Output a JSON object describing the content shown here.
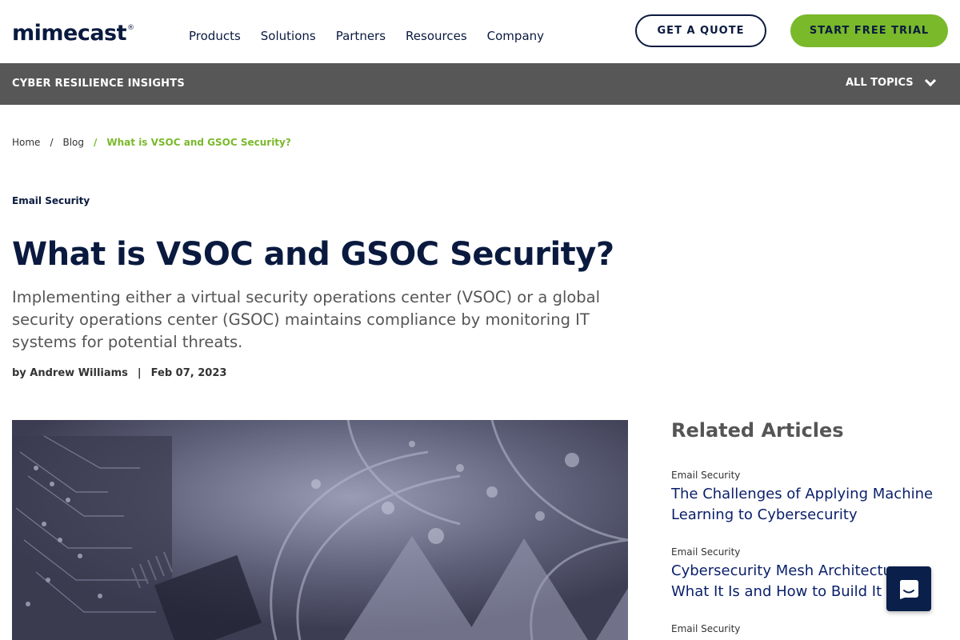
{
  "header": {
    "logo": "mimecast",
    "logo_mark": "®",
    "nav": [
      "Products",
      "Solutions",
      "Partners",
      "Resources",
      "Company"
    ],
    "quote_label": "GET A QUOTE",
    "trial_label": "START FREE TRIAL"
  },
  "subbar": {
    "title": "CYBER RESILIENCE INSIGHTS",
    "topics_label": "ALL TOPICS"
  },
  "breadcrumb": {
    "home": "Home",
    "blog": "Blog",
    "separator": "/",
    "current": "What is VSOC and GSOC Security?"
  },
  "article": {
    "category": "Email Security",
    "title": "What is VSOC and GSOC Security?",
    "subtitle": "Implementing either a virtual security operations center (VSOC) or a global security operations center (GSOC) maintains compliance by monitoring IT systems for potential threats.",
    "author": "by Andrew Williams",
    "byline_separator": "|",
    "date": "Feb 07, 2023"
  },
  "related": {
    "heading": "Related Articles",
    "items": [
      {
        "category": "Email Security",
        "title": "The Challenges of Applying Machine Learning to Cybersecurity"
      },
      {
        "category": "Email Security",
        "title": "Cybersecurity Mesh Architecture: What It Is and How to Build It"
      },
      {
        "category": "Email Security",
        "title": ""
      }
    ]
  },
  "colors": {
    "brand_navy": "#0a1a3f",
    "accent_green": "#79b92a",
    "subbar_gray": "#575757"
  },
  "icons": {
    "chevron": "chevron-down-icon",
    "chat": "chat-icon"
  }
}
